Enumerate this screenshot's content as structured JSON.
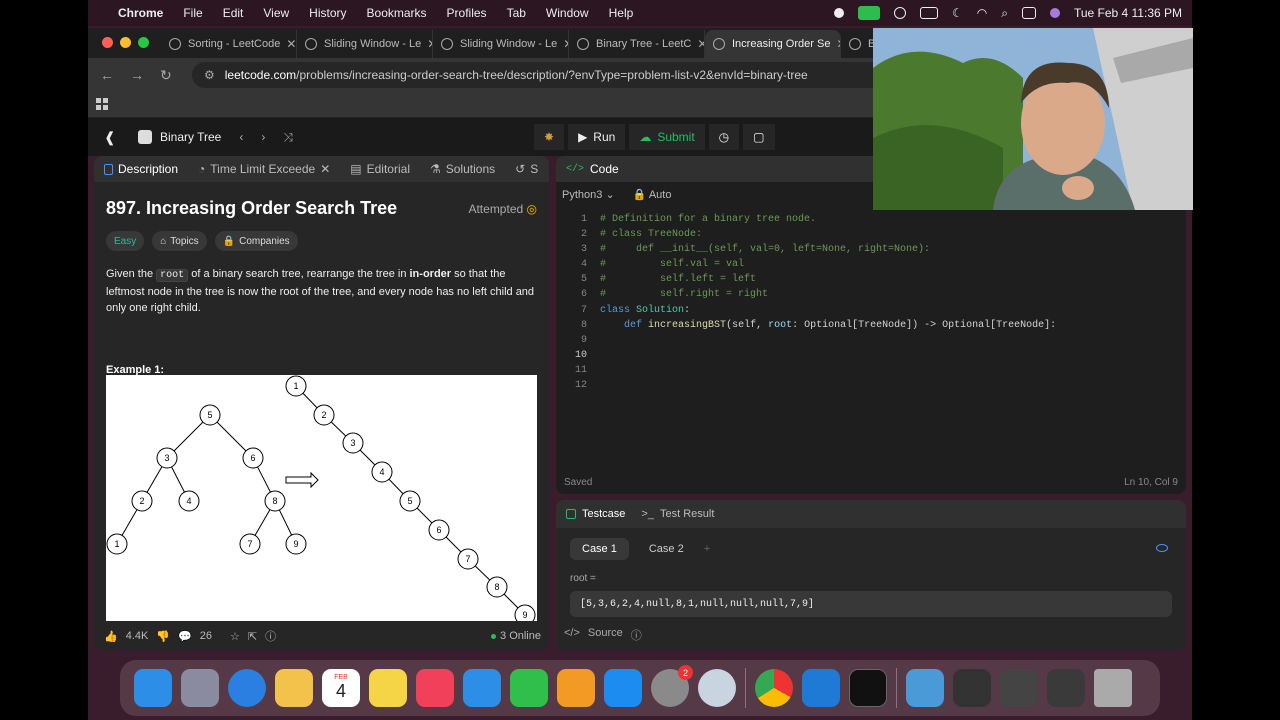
{
  "menubar": {
    "app": "Chrome",
    "items": [
      "File",
      "Edit",
      "View",
      "History",
      "Bookmarks",
      "Profiles",
      "Tab",
      "Window",
      "Help"
    ],
    "datetime": "Tue Feb 4  11:36 PM"
  },
  "tabs": [
    {
      "label": "Sorting - LeetCode"
    },
    {
      "label": "Sliding Window - Le"
    },
    {
      "label": "Sliding Window - Le"
    },
    {
      "label": "Binary Tree - LeetC"
    },
    {
      "label": "Increasing Order Se"
    },
    {
      "label": "Bin"
    }
  ],
  "address": {
    "host": "leetcode.com",
    "path": "/problems/increasing-order-search-tree/description/?envType=problem-list-v2&envId=binary-tree"
  },
  "leetcode": {
    "list_title": "Binary Tree",
    "run_label": "Run",
    "submit_label": "Submit"
  },
  "left_tabs": [
    "Description",
    "Time Limit Exceede",
    "Editorial",
    "Solutions",
    "S"
  ],
  "problem": {
    "title": "897. Increasing Order Search Tree",
    "status": "Attempted",
    "difficulty": "Easy",
    "topics": "Topics",
    "companies": "Companies",
    "desc_1": "Given the ",
    "code_root": "root",
    "desc_2": " of a binary search tree, rearrange the tree in ",
    "desc_bold": "in-order",
    "desc_3": " so that the leftmost node in the tree is now the root of the tree, and every node has no left child and only one right child.",
    "example_label": "Example 1:"
  },
  "tree_left": {
    "nodes": [
      "5",
      "3",
      "6",
      "2",
      "4",
      "8",
      "1",
      "7",
      "9"
    ]
  },
  "tree_right": {
    "nodes": [
      "1",
      "2",
      "3",
      "4",
      "5",
      "6",
      "7",
      "8",
      "9"
    ]
  },
  "footer": {
    "likes": "4.4K",
    "comments": "26",
    "online": "3 Online"
  },
  "code_panel": {
    "title": "Code",
    "language": "Python3",
    "mode": "Auto",
    "saved": "Saved",
    "cursor": "Ln 10, Col 9",
    "lines": [
      {
        "n": "1",
        "t": "# Definition for a binary tree node."
      },
      {
        "n": "2",
        "t": "# class TreeNode:"
      },
      {
        "n": "3",
        "t": "#     def __init__(self, val=0, left=None, right=None):"
      },
      {
        "n": "4",
        "t": "#         self.val = val"
      },
      {
        "n": "5",
        "t": "#         self.left = left"
      },
      {
        "n": "6",
        "t": "#         self.right = right"
      },
      {
        "n": "7",
        "t": "class Solution:"
      },
      {
        "n": "8",
        "t": "    def increasingBST(self, root: Optional[TreeNode]) -> Optional[TreeNode]:"
      },
      {
        "n": "9",
        "t": ""
      },
      {
        "n": "10",
        "t": ""
      },
      {
        "n": "11",
        "t": ""
      },
      {
        "n": "12",
        "t": ""
      }
    ]
  },
  "test_panel": {
    "testcase_label": "Testcase",
    "result_label": "Test Result",
    "cases": [
      "Case 1",
      "Case 2"
    ],
    "root_label": "root =",
    "root_value": "[5,3,6,2,4,null,8,1,null,null,null,7,9]",
    "source": "Source"
  },
  "dock": {
    "calendar_month": "FEB",
    "calendar_day": "4",
    "badge": "2"
  },
  "colors": {
    "accent_green": "#2cbb5d",
    "easy": "#2db8a0",
    "link_blue": "#4c8dff"
  }
}
